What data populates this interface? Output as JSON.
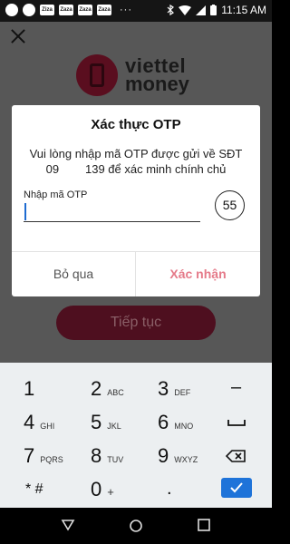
{
  "status_bar": {
    "time": "11:15 AM",
    "notif_dots": "···",
    "news_labels": [
      "Ziza",
      "Zaza",
      "Zaza",
      "Zaza"
    ]
  },
  "background_app": {
    "logo_line1": "viettel",
    "logo_line2": "money",
    "continue_label": "Tiếp tục"
  },
  "otp_dialog": {
    "title": "Xác thực OTP",
    "message_line1": "Vui lòng nhập mã OTP được gửi về SĐT",
    "message_line2": "09        139 để xác minh chính chủ",
    "input_label": "Nhập mã OTP",
    "input_value": "",
    "countdown": "55",
    "skip_label": "Bỏ qua",
    "confirm_label": "Xác nhận",
    "confirm_color": "#e57a89"
  },
  "keyboard": {
    "rows": [
      [
        {
          "num": "1",
          "let": ""
        },
        {
          "num": "2",
          "let": "ABC"
        },
        {
          "num": "3",
          "let": "DEF"
        },
        {
          "sym": "–"
        }
      ],
      [
        {
          "num": "4",
          "let": "GHI"
        },
        {
          "num": "5",
          "let": "JKL"
        },
        {
          "num": "6",
          "let": "MNO"
        },
        {
          "sym": "space"
        }
      ],
      [
        {
          "num": "7",
          "let": "PQRS"
        },
        {
          "num": "8",
          "let": "TUV"
        },
        {
          "num": "9",
          "let": "WXYZ"
        },
        {
          "sym": "backspace"
        }
      ],
      [
        {
          "sym": "* #"
        },
        {
          "num": "0",
          "let": "+"
        },
        {
          "sym": "."
        },
        {
          "sym": "enter"
        }
      ]
    ],
    "accent_color": "#1e73d9"
  }
}
